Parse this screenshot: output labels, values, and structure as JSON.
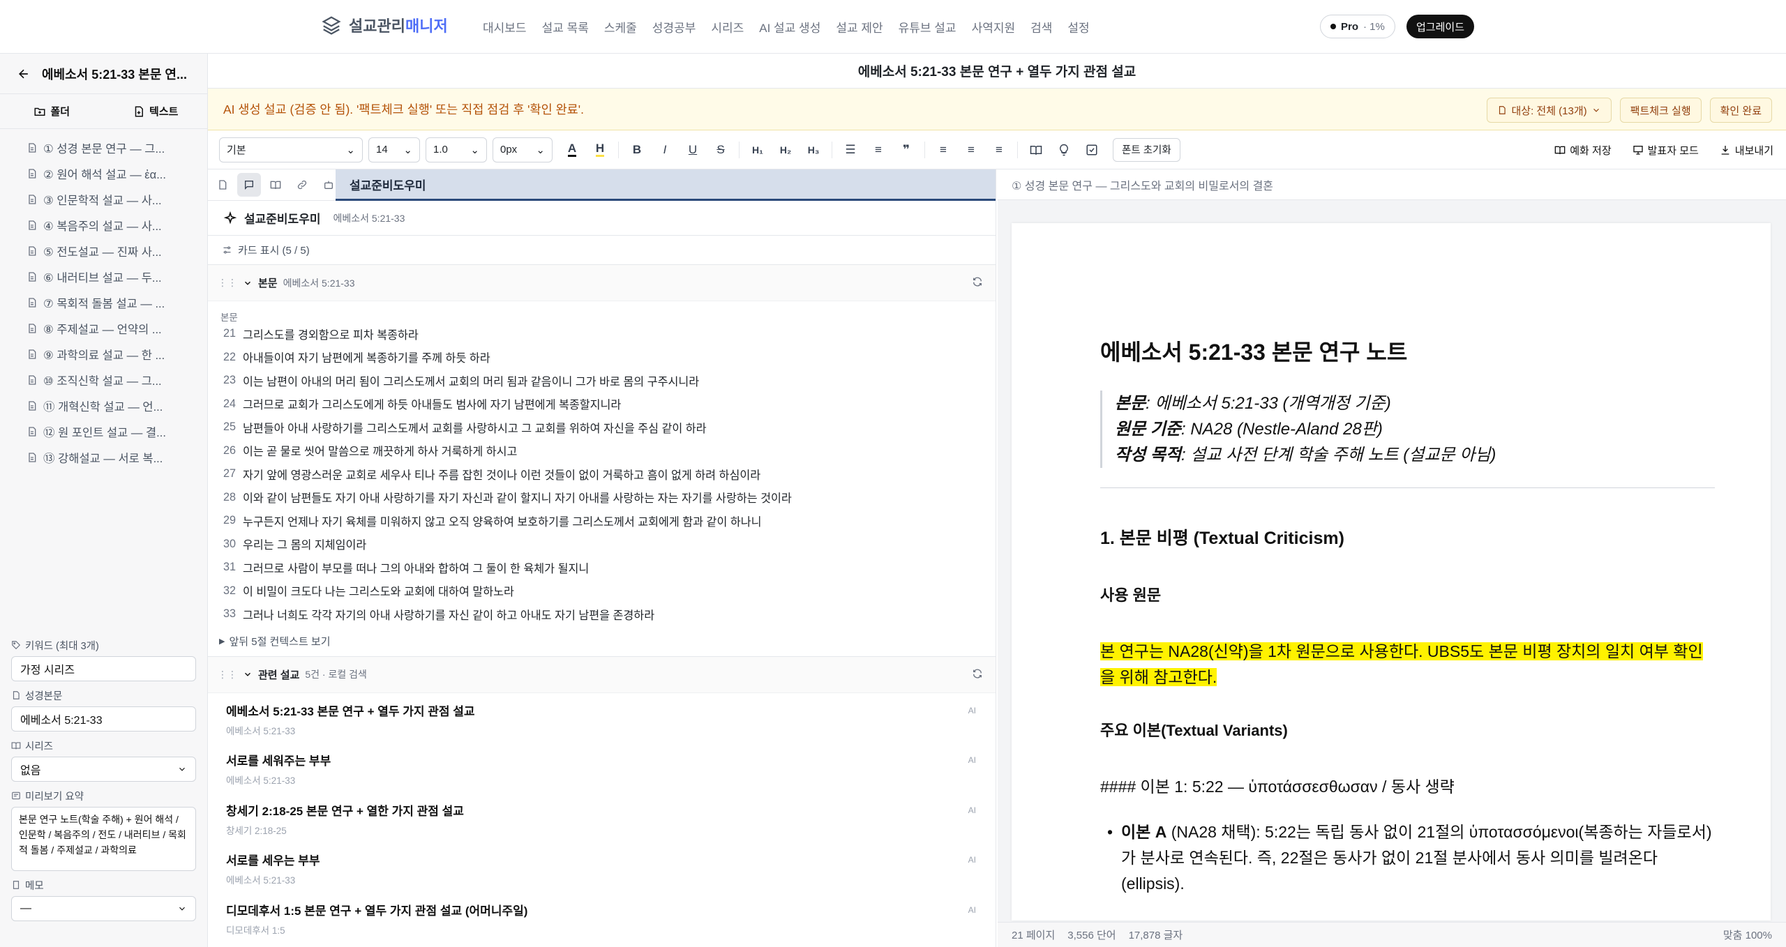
{
  "nav": {
    "brand_part1": "설교관리",
    "brand_part2": "매니저",
    "links": [
      "대시보드",
      "설교 목록",
      "스케줄",
      "성경공부",
      "시리즈",
      "AI 설교 생성",
      "설교 제안",
      "유튜브 설교",
      "사역지원",
      "검색",
      "설정"
    ],
    "plan": "Pro",
    "plan_usage": "· 1%",
    "upgrade": "업그레이드"
  },
  "sidebar": {
    "title": "에베소서 5:21-33 본문 연...",
    "tab_folder": "폴더",
    "tab_text": "텍스트",
    "items": [
      "① 성경 본문 연구 — 그...",
      "② 원어 해석 설교 — ἐα...",
      "③ 인문학적 설교 — 사...",
      "④ 복음주의 설교 — 사...",
      "⑤ 전도설교 — 진짜 사...",
      "⑥ 내러티브 설교 — 두...",
      "⑦ 목회적 돌봄 설교 — ...",
      "⑧ 주제설교 — 언약의 ...",
      "⑨ 과학의료 설교 — 한 ...",
      "⑩ 조직신학 설교 — 그...",
      "⑪ 개혁신학 설교 — 언...",
      "⑫ 원 포인트 설교 — 결...",
      "⑬ 강해설교 — 서로 복..."
    ],
    "keywords_label": "키워드 (최대 3개)",
    "keywords_value": "가정 시리즈",
    "scripture_label": "성경본문",
    "scripture_value": "에베소서 5:21-33",
    "series_label": "시리즈",
    "series_value": "없음",
    "summary_label": "미리보기 요약",
    "summary_value": "본문 연구 노트(학술 주해) + 원어 해석 / 인문학 / 복음주의 / 전도 / 내러티브 / 목회적 돌봄 / 주제설교 / 과학의료",
    "memo_label": "메모",
    "memo_value": "—"
  },
  "main": {
    "title": "에베소서 5:21-33 본문 연구 + 열두 가지 관점 설교",
    "banner_text": "AI 생성 설교 (검증 안 됨). '팩트체크 실행' 또는 직접 점검 후 '확인 완료'.",
    "target_label": "대상: 전체 (13개)",
    "factcheck": "팩트체크 실행",
    "confirm": "확인 완료"
  },
  "toolbar": {
    "style": "기본",
    "font_size": "14",
    "line_height": "1.0",
    "spacing": "0px",
    "reset": "폰트 초기화",
    "save_example": "예화 저장",
    "presenter": "발표자 모드",
    "export": "내보내기"
  },
  "helper": {
    "tab_label": "설교준비도우미",
    "title": "설교준비도우미",
    "ref": "에베소서 5:21-33",
    "card_toggle": "카드 표시 (5 / 5)"
  },
  "passage": {
    "title": "본문",
    "ref": "에베소서 5:21-33",
    "label": "본문",
    "verses": [
      {
        "n": "21",
        "t": "그리스도를 경외함으로 피차 복종하라"
      },
      {
        "n": "22",
        "t": "아내들이여 자기 남편에게 복종하기를 주께 하듯 하라"
      },
      {
        "n": "23",
        "t": "이는 남편이 아내의 머리 됨이 그리스도께서 교회의 머리 됨과 같음이니 그가 바로 몸의 구주시니라"
      },
      {
        "n": "24",
        "t": "그러므로 교회가 그리스도에게 하듯 아내들도 범사에 자기 남편에게 복종할지니라"
      },
      {
        "n": "25",
        "t": "남편들아 아내 사랑하기를 그리스도께서 교회를 사랑하시고 그 교회를 위하여 자신을 주심 같이 하라"
      },
      {
        "n": "26",
        "t": "이는 곧 물로 씻어 말씀으로 깨끗하게 하사 거룩하게 하시고"
      },
      {
        "n": "27",
        "t": "자기 앞에 영광스러운 교회로 세우사 티나 주름 잡힌 것이나 이런 것들이 없이 거룩하고 흠이 없게 하려 하심이라"
      },
      {
        "n": "28",
        "t": "이와 같이 남편들도 자기 아내 사랑하기를 자기 자신과 같이 할지니 자기 아내를 사랑하는 자는 자기를 사랑하는 것이라"
      },
      {
        "n": "29",
        "t": "누구든지 언제나 자기 육체를 미워하지 않고 오직 양육하여 보호하기를 그리스도께서 교회에게 함과 같이 하나니"
      },
      {
        "n": "30",
        "t": "우리는 그 몸의 지체임이라"
      },
      {
        "n": "31",
        "t": "그러므로 사람이 부모를 떠나 그의 아내와 합하여 그 둘이 한 육체가 될지니"
      },
      {
        "n": "32",
        "t": "이 비밀이 크도다 나는 그리스도와 교회에 대하여 말하노라"
      },
      {
        "n": "33",
        "t": "그러나 너희도 각각 자기의 아내 사랑하기를 자신 같이 하고 아내도 자기 남편을 존경하라"
      }
    ],
    "context_toggle": "앞뒤 5절 컨텍스트 보기"
  },
  "related": {
    "title": "관련 설교",
    "meta": "5건 · 로컬 검색",
    "items": [
      {
        "title": "에베소서 5:21-33 본문 연구 + 열두 가지 관점 설교",
        "ref": "에베소서 5:21-33",
        "badge": "AI"
      },
      {
        "title": "서로를 세워주는 부부",
        "ref": "에베소서 5:21-33",
        "badge": "AI"
      },
      {
        "title": "창세기 2:18-25 본문 연구 + 열한 가지 관점 설교",
        "ref": "창세기 2:18-25",
        "badge": "AI"
      },
      {
        "title": "서로를 세우는 부부",
        "ref": "에베소서 5:21-33",
        "badge": "AI"
      },
      {
        "title": "디모데후서 1:5 본문 연구 + 열두 가지 관점 설교 (어머니주일)",
        "ref": "디모데후서 1:5",
        "badge": "AI"
      }
    ]
  },
  "preview": {
    "header": "① 성경 본문 연구 — 그리스도와 교회의 비밀로서의 결혼",
    "h1": "에베소서 5:21-33 본문 연구 노트",
    "meta": [
      {
        "k": "본문",
        "v": ": 에베소서 5:21-33 (개역개정 기준)"
      },
      {
        "k": "원문 기준",
        "v": ": NA28 (Nestle-Aland 28판)"
      },
      {
        "k": "작성 목적",
        "v": ": 설교 사전 단계 학술 주해 노트 (설교문 아님)"
      }
    ],
    "h2": "1. 본문 비평 (Textual Criticism)",
    "h3_source": "사용 원문",
    "highlight": "본 연구는 NA28(신약)을 1차 원문으로 사용한다. UBS5도 본문 비평 장치의 일치 여부 확인을 위해 참고한다.",
    "h3_variants": "주요 이본(Textual Variants)",
    "variant_line": "#### 이본 1: 5:22 — ὑποτάσσεσθωσαν / 동사 생략",
    "bullet_bold": "이본 A",
    "bullet_text": " (NA28 채택): 5:22는 독립 동사 없이 21절의 ὑποτασσόμενοι(복종하는 자들로서)가 분사로 연속된다. 즉, 22절은 동사가 없이 21절 분사에서 동사 의미를 빌려온다(ellipsis)."
  },
  "status": {
    "pages": "21 페이지",
    "words": "3,556 단어",
    "chars": "17,878 글자",
    "zoom": "맞춤 100%"
  }
}
